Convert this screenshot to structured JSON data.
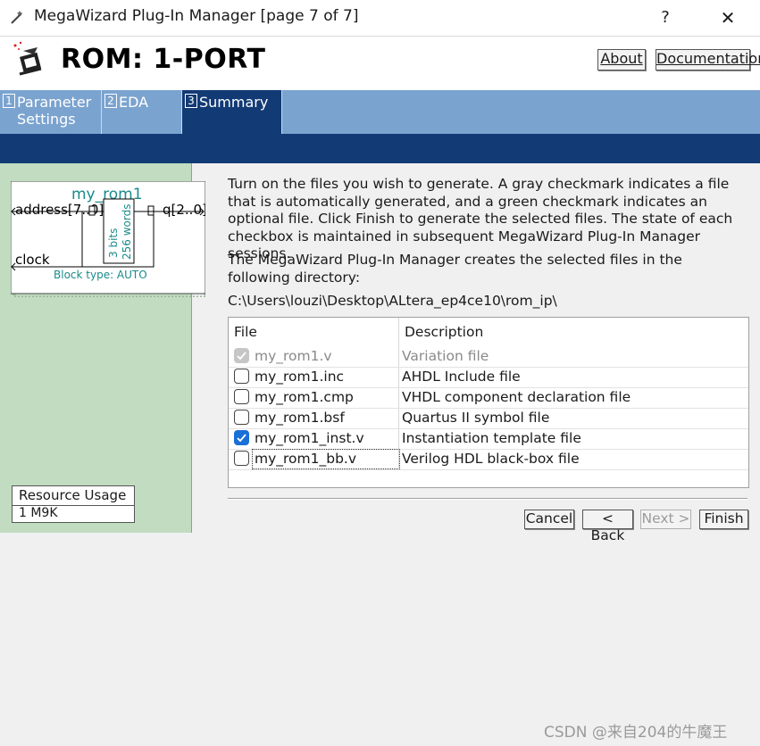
{
  "window": {
    "title": "MegaWizard Plug-In Manager [page 7 of 7]",
    "help": "?",
    "close": "✕"
  },
  "header": {
    "heading": "ROM: 1-PORT",
    "about": "About",
    "documentation": "Documentation"
  },
  "tabs": [
    {
      "num": "1",
      "label": "Parameter\nSettings"
    },
    {
      "num": "2",
      "label": "EDA"
    },
    {
      "num": "3",
      "label": "Summary"
    }
  ],
  "symbol": {
    "name": "my_rom1",
    "address": "address[7..0]",
    "q": "q[2..0]",
    "bits": "3 bits",
    "words": "256 words",
    "clock": "clock",
    "block_type": "Block type: AUTO"
  },
  "resource": {
    "label": "Resource Usage",
    "value": "1 M9K"
  },
  "content": {
    "description": "Turn on the files you wish to generate. A gray checkmark indicates a file that is automatically generated, and a green checkmark indicates an optional file. Click Finish to generate the selected files. The state of each checkbox is maintained in subsequent MegaWizard Plug-In Manager sessions.",
    "directory_note": "The MegaWizard Plug-In Manager creates the selected files in the following directory:",
    "path": "C:\\Users\\louzi\\Desktop\\ALtera_ep4ce10\\rom_ip\\"
  },
  "table": {
    "col_file": "File",
    "col_desc": "Description",
    "rows": [
      {
        "file": "my_rom1.v",
        "desc": "Variation file",
        "state": "grey"
      },
      {
        "file": "my_rom1.inc",
        "desc": "AHDL Include file",
        "state": "off"
      },
      {
        "file": "my_rom1.cmp",
        "desc": "VHDL component declaration file",
        "state": "off"
      },
      {
        "file": "my_rom1.bsf",
        "desc": "Quartus II symbol file",
        "state": "off"
      },
      {
        "file": "my_rom1_inst.v",
        "desc": "Instantiation template file",
        "state": "on"
      },
      {
        "file": "my_rom1_bb.v",
        "desc": "Verilog HDL black-box file",
        "state": "off"
      }
    ]
  },
  "buttons": {
    "cancel": "Cancel",
    "back": "< Back",
    "next": "Next >",
    "finish": "Finish"
  },
  "watermark": "CSDN @来自204的牛魔王",
  "colors": {
    "tab_bar": "#7ba3cf",
    "tab_active": "#123a75",
    "left_panel": "#c1dcc0",
    "symbol_text": "#1a8a8a",
    "check_on": "#1a6fd6"
  }
}
